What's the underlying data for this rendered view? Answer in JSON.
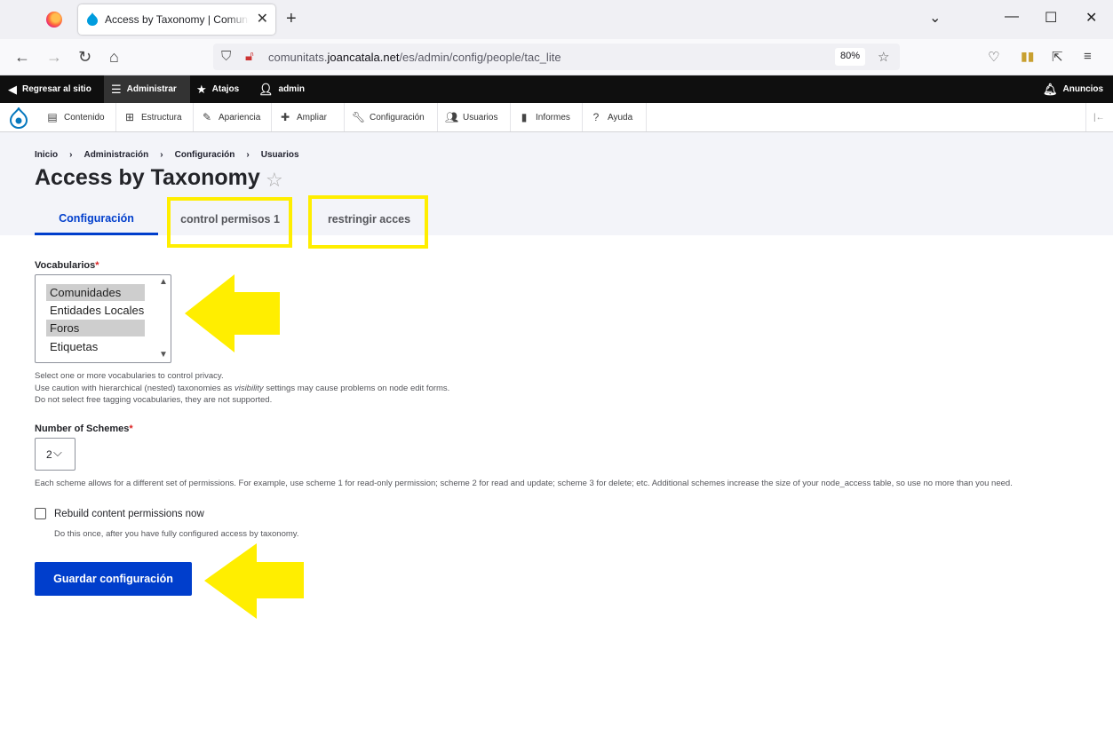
{
  "browser": {
    "tab_title": "Access by Taxonomy | Comunitats",
    "url_prefix": "comunitats.",
    "url_host": "joancatala.net",
    "url_path": "/es/admin/config/people/tac_lite",
    "zoom": "80%"
  },
  "toolbar": {
    "back_to_site": "Regresar al sitio",
    "manage": "Administrar",
    "shortcuts": "Atajos",
    "user": "admin",
    "announcements": "Anuncios"
  },
  "tray": {
    "items": [
      "Contenido",
      "Estructura",
      "Apariencia",
      "Ampliar",
      "Configuración",
      "Usuarios",
      "Informes",
      "Ayuda"
    ]
  },
  "breadcrumb": [
    "Inicio",
    "Administración",
    "Configuración",
    "Usuarios"
  ],
  "page_title": "Access by Taxonomy",
  "tabs": [
    "Configuración",
    "control permisos 1",
    "restringir acces"
  ],
  "form": {
    "vocabularies_label": "Vocabularios",
    "required_mark": "*",
    "vocabularies": [
      {
        "label": "Comunidades",
        "selected": true
      },
      {
        "label": "Entidades Locales",
        "selected": false
      },
      {
        "label": "Foros",
        "selected": true
      },
      {
        "label": "Etiquetas",
        "selected": false
      }
    ],
    "vocab_help_1": "Select one or more vocabularies to control privacy.",
    "vocab_help_2_a": "Use caution with hierarchical (nested) taxonomies as ",
    "vocab_help_2_em": "visibility",
    "vocab_help_2_b": " settings may cause problems on node edit forms.",
    "vocab_help_3": "Do not select free tagging vocabularies, they are not supported.",
    "schemes_label": "Number of Schemes",
    "schemes_value": "2",
    "schemes_help": "Each scheme allows for a different set of permissions. For example, use scheme 1 for read-only permission; scheme 2 for read and update; scheme 3 for delete; etc. Additional schemes increase the size of your node_access table, so use no more than you need.",
    "rebuild_label": "Rebuild content permissions now",
    "rebuild_help": "Do this once, after you have fully configured access by taxonomy.",
    "save_label": "Guardar configuración"
  },
  "colors": {
    "accent": "#003ecc",
    "annotation": "#ffee00"
  }
}
